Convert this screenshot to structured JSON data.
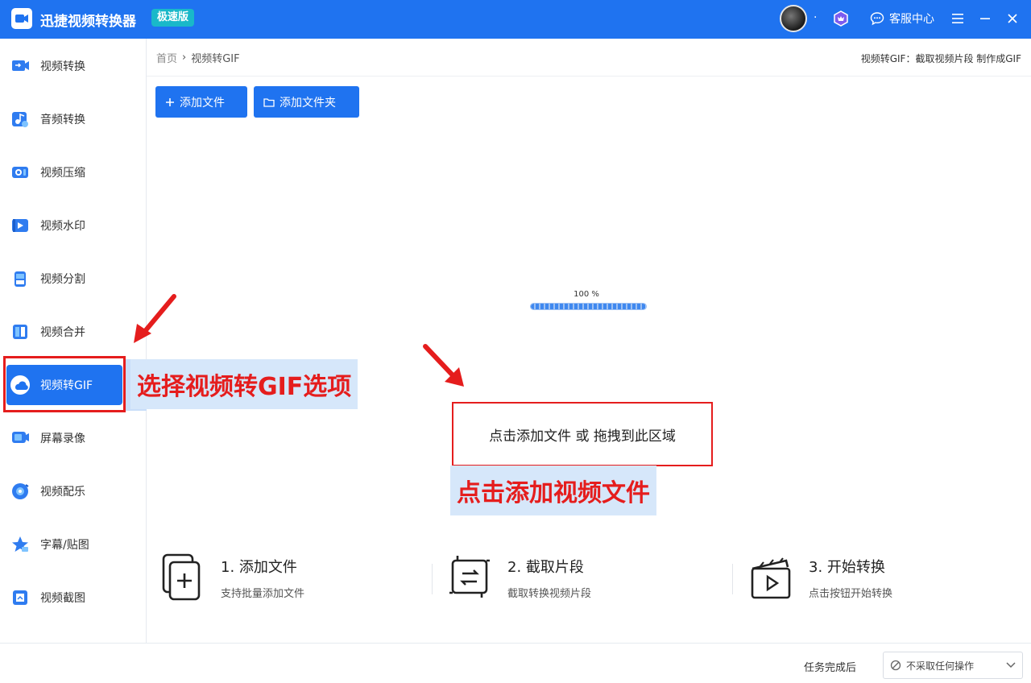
{
  "app": {
    "title": "迅捷视频转换器",
    "edition": "极速版",
    "support_label": "客服中心",
    "brand_color": "#1f73f0"
  },
  "sidebar": {
    "items": [
      {
        "label": "视频转换",
        "icon": "video-convert-icon"
      },
      {
        "label": "音频转换",
        "icon": "audio-convert-icon"
      },
      {
        "label": "视频压缩",
        "icon": "video-compress-icon"
      },
      {
        "label": "视频水印",
        "icon": "video-watermark-icon"
      },
      {
        "label": "视频分割",
        "icon": "video-split-icon"
      },
      {
        "label": "视频合并",
        "icon": "video-merge-icon"
      },
      {
        "label": "视频转GIF",
        "icon": "video-to-gif-icon",
        "active": true
      },
      {
        "label": "屏幕录像",
        "icon": "screen-record-icon"
      },
      {
        "label": "视频配乐",
        "icon": "video-music-icon"
      },
      {
        "label": "字幕/贴图",
        "icon": "subtitle-sticker-icon"
      },
      {
        "label": "视频截图",
        "icon": "video-screenshot-icon"
      }
    ]
  },
  "breadcrumb": {
    "home": "首页",
    "separator": "›",
    "current": "视频转GIF"
  },
  "header_hint": "视频转GIF：截取视频片段 制作成GIF",
  "toolbar": {
    "add_file": "添加文件",
    "add_folder": "添加文件夹"
  },
  "progress": {
    "label": "100 %",
    "value": 100
  },
  "drop_zone": {
    "text": "点击添加文件 或 拖拽到此区域"
  },
  "annotations": {
    "select_gif": "选择视频转GIF选项",
    "click_add": "点击添加视频文件",
    "highlight_color": "#e51d1d"
  },
  "steps": [
    {
      "title": "1. 添加文件",
      "desc": "支持批量添加文件",
      "icon": "add-file-icon"
    },
    {
      "title": "2. 截取片段",
      "desc": "截取转换视频片段",
      "icon": "clip-segment-icon"
    },
    {
      "title": "3. 开始转换",
      "desc": "点击按钮开始转换",
      "icon": "clapperboard-icon"
    }
  ],
  "footer": {
    "after_task_label": "任务完成后",
    "after_task_value": "不采取任何操作"
  }
}
